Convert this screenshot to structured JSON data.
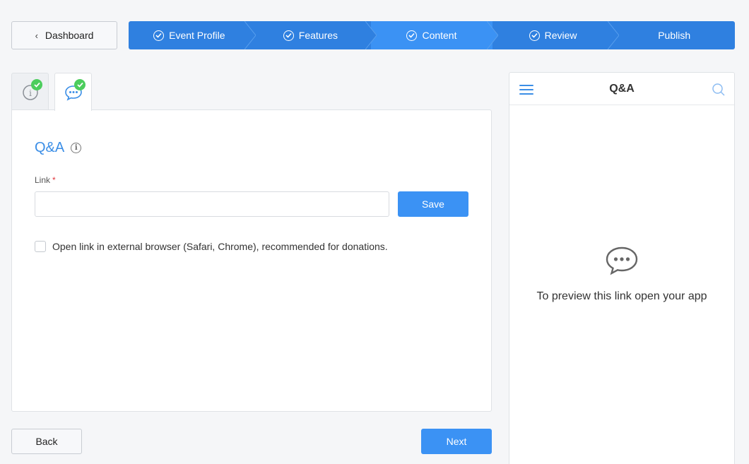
{
  "nav": {
    "dashboard_label": "Dashboard"
  },
  "stepper": {
    "steps": [
      {
        "label": "Event Profile",
        "done": true
      },
      {
        "label": "Features",
        "done": true
      },
      {
        "label": "Content",
        "done": true,
        "active": true
      },
      {
        "label": "Review",
        "done": true
      },
      {
        "label": "Publish",
        "done": false
      }
    ]
  },
  "tabs": [
    {
      "icon": "info-icon",
      "completed": true
    },
    {
      "icon": "chat-bubble-icon",
      "completed": true,
      "selected": true
    }
  ],
  "content": {
    "title": "Q&A",
    "link_label": "Link",
    "required_mark": "*",
    "link_value": "",
    "save_label": "Save",
    "external_checkbox_label": "Open link in external browser (Safari, Chrome), recommended for donations.",
    "external_checked": false
  },
  "footer": {
    "back_label": "Back",
    "next_label": "Next"
  },
  "preview": {
    "title": "Q&A",
    "message": "To preview this link open your app"
  },
  "colors": {
    "accent": "#3b92f4",
    "stepper": "#2f80e0",
    "success": "#4ccd5d"
  }
}
